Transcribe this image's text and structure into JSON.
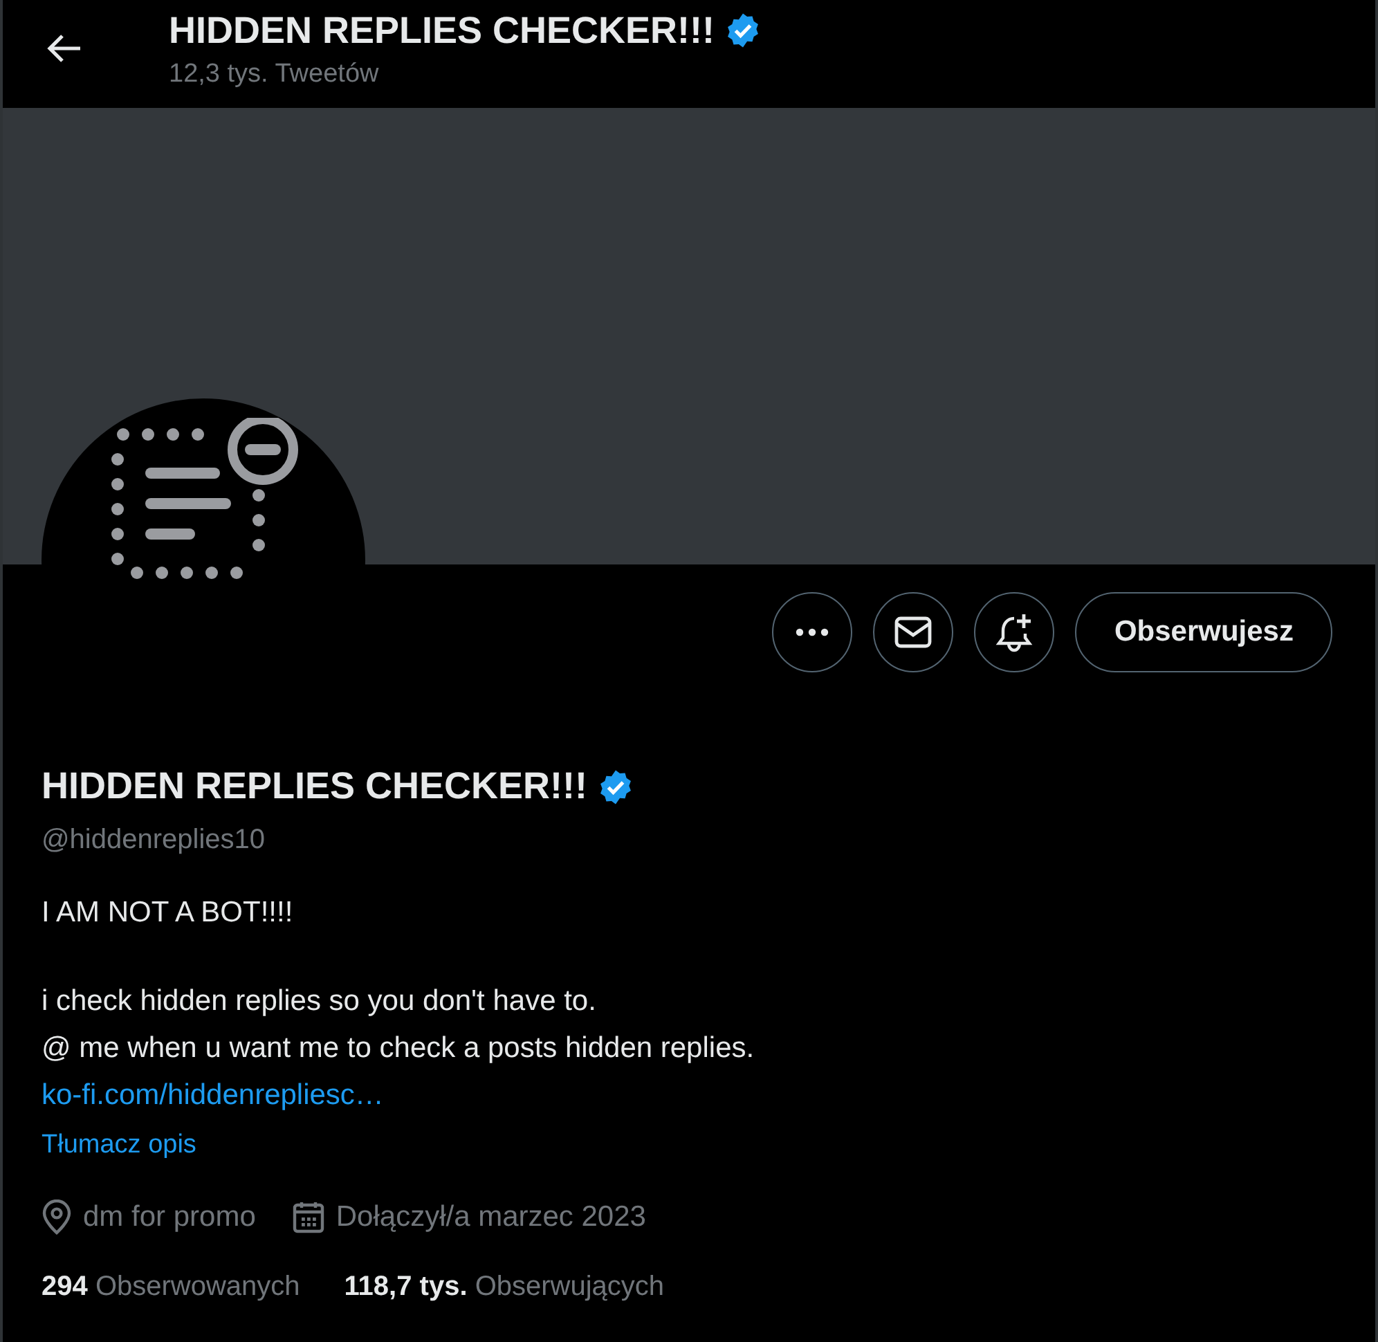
{
  "header": {
    "title": "HIDDEN REPLIES CHECKER!!!",
    "verified": true,
    "subtitle": "12,3 tys. Tweetów"
  },
  "actions": {
    "follow_label": "Obserwujesz"
  },
  "profile": {
    "name": "HIDDEN REPLIES CHECKER!!!",
    "verified": true,
    "handle": "@hiddenreplies10",
    "bio": [
      [
        "I AM NOT A BOT!!!!"
      ],
      [
        "i check hidden replies so you don't have to.",
        "@ me when u want me to check a posts hidden replies."
      ]
    ],
    "link": "ko-fi.com/hiddenrepliesc…",
    "translate": "Tłumacz opis",
    "location": "dm for promo",
    "joined": "Dołączył/a marzec 2023"
  },
  "stats": [
    {
      "count": "294",
      "label": "Obserwowanych"
    },
    {
      "count": "118,7 tys.",
      "label": "Obserwujących"
    }
  ]
}
